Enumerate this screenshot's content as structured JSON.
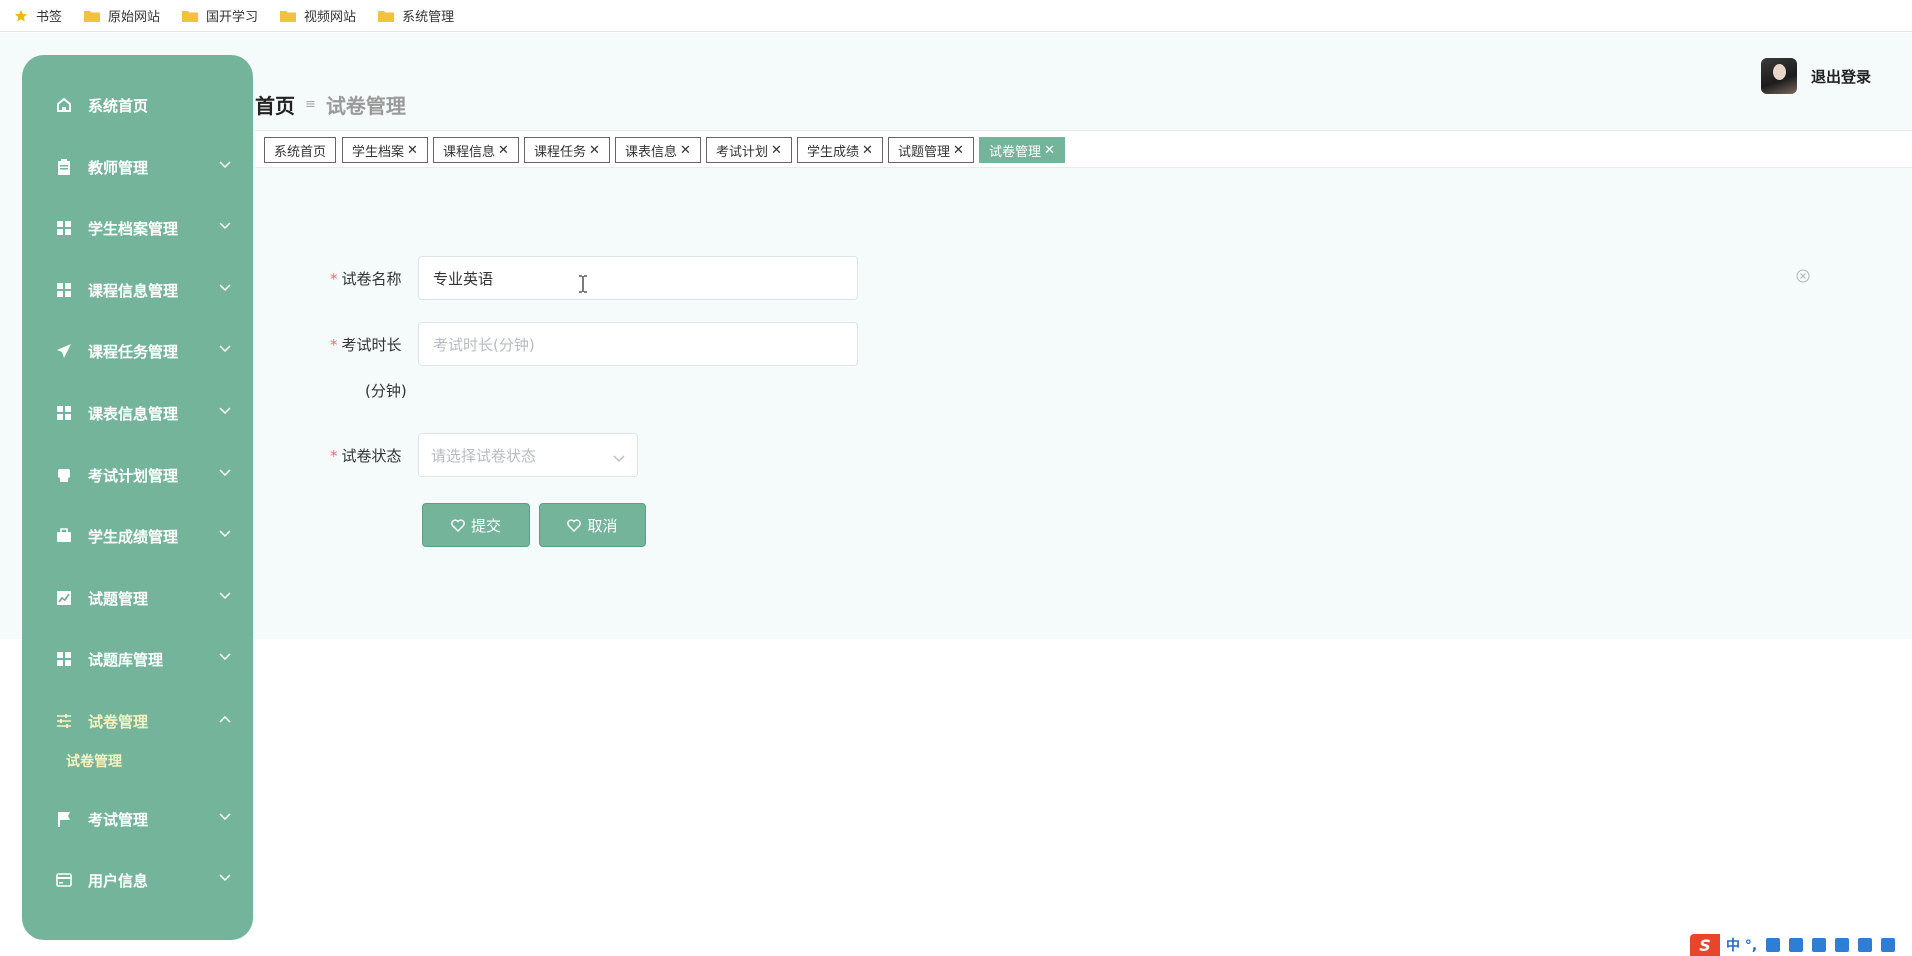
{
  "bookmarks": [
    {
      "label": "书签",
      "icon": "star-icon"
    },
    {
      "label": "原始网站",
      "icon": "folder-icon"
    },
    {
      "label": "国开学习",
      "icon": "folder-icon"
    },
    {
      "label": "视频网站",
      "icon": "folder-icon"
    },
    {
      "label": "系统管理",
      "icon": "folder-icon"
    }
  ],
  "sidebar": {
    "items": [
      {
        "label": "系统首页",
        "icon": "home-icon"
      },
      {
        "label": "教师管理",
        "icon": "clipboard-icon"
      },
      {
        "label": "学生档案管理",
        "icon": "grid-icon"
      },
      {
        "label": "课程信息管理",
        "icon": "grid-icon"
      },
      {
        "label": "课程任务管理",
        "icon": "paper-plane-icon"
      },
      {
        "label": "课表信息管理",
        "icon": "grid-icon"
      },
      {
        "label": "考试计划管理",
        "icon": "printer-icon"
      },
      {
        "label": "学生成绩管理",
        "icon": "briefcase-icon"
      },
      {
        "label": "试题管理",
        "icon": "chart-icon"
      },
      {
        "label": "试题库管理",
        "icon": "grid-icon"
      },
      {
        "label": "试卷管理",
        "icon": "sliders-icon"
      },
      {
        "label": "考试管理",
        "icon": "flag-icon"
      },
      {
        "label": "用户信息",
        "icon": "card-icon"
      }
    ],
    "sub_item": "试卷管理"
  },
  "header": {
    "breadcrumb_home": "首页",
    "breadcrumb_sep": "≡",
    "breadcrumb_current": "试卷管理",
    "logout": "退出登录"
  },
  "tabs": [
    {
      "label": "系统首页",
      "closable": false
    },
    {
      "label": "学生档案",
      "closable": true
    },
    {
      "label": "课程信息",
      "closable": true
    },
    {
      "label": "课程任务",
      "closable": true
    },
    {
      "label": "课表信息",
      "closable": true
    },
    {
      "label": "考试计划",
      "closable": true
    },
    {
      "label": "学生成绩",
      "closable": true
    },
    {
      "label": "试题管理",
      "closable": true
    },
    {
      "label": "试卷管理",
      "closable": true,
      "active": true
    }
  ],
  "form": {
    "name_label": "试卷名称",
    "name_value": "专业英语",
    "duration_label": "考试时长",
    "duration_label_2": "(分钟)",
    "duration_placeholder": "考试时长(分钟)",
    "status_label": "试卷状态",
    "status_placeholder": "请选择试卷状态",
    "required_mark": "*",
    "submit": "提交",
    "cancel": "取消"
  },
  "ime": {
    "logo": "S",
    "mode": "中 °,"
  },
  "colors": {
    "accent": "#74b49b",
    "required": "#f56c6c",
    "active_text": "#f7f0c0"
  }
}
